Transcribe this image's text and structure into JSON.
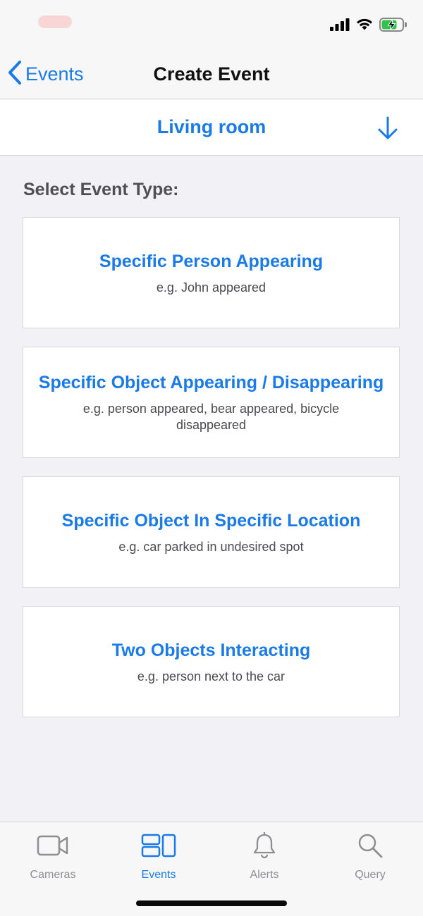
{
  "status_bar": {
    "icons": [
      "cellular-signal-icon",
      "wifi-icon",
      "battery-charging-icon"
    ]
  },
  "nav": {
    "back_label": "Events",
    "title": "Create Event"
  },
  "camera_selector": {
    "value": "Living room",
    "icon": "arrow-down-icon"
  },
  "section_heading": "Select Event Type:",
  "event_types": [
    {
      "title": "Specific Person Appearing",
      "description": "e.g. John appeared"
    },
    {
      "title": "Specific Object Appearing / Disappearing",
      "description": "e.g. person appeared, bear appeared, bicycle disappeared"
    },
    {
      "title": "Specific Object In Specific Location",
      "description": "e.g. car parked in undesired spot"
    },
    {
      "title": "Two Objects Interacting",
      "description": "e.g. person next to the car"
    }
  ],
  "tabs": [
    {
      "label": "Cameras",
      "icon": "video-camera-icon",
      "active": false
    },
    {
      "label": "Events",
      "icon": "events-grid-icon",
      "active": true
    },
    {
      "label": "Alerts",
      "icon": "bell-icon",
      "active": false
    },
    {
      "label": "Query",
      "icon": "magnifier-icon",
      "active": false
    }
  ],
  "colors": {
    "accent": "#1a7ae8",
    "background": "#f2f2f6",
    "inactive_tab": "#8e8e93"
  }
}
